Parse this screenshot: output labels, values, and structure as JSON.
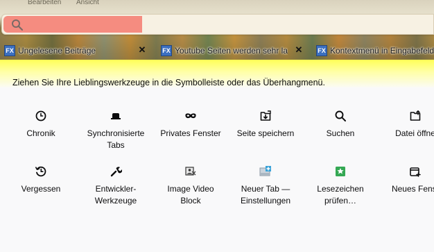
{
  "window": {
    "menu_ghost": [
      "Bearbeiten",
      "Ansicht"
    ]
  },
  "urlbar": {
    "icon": "search-icon",
    "highlight_color": "#f58c80"
  },
  "tabs": [
    {
      "label": "Ungelesene Beiträge",
      "favicon": "FX",
      "close": "✕"
    },
    {
      "label": "Youtube Seiten werden sehr la",
      "favicon": "FX",
      "close": "✕"
    },
    {
      "label": "Kontextmenü in Eingabefeld",
      "favicon": "FX",
      "close": ""
    }
  ],
  "customize": {
    "instruction": "Ziehen Sie Ihre Lieblingswerkzeuge in die Symbolleiste oder das Überhangmenü."
  },
  "palette": [
    {
      "label": "Chronik",
      "icon": "clock-icon"
    },
    {
      "label": "Synchronisierte\nTabs",
      "icon": "sync-tabs-icon"
    },
    {
      "label": "Privates Fenster",
      "icon": "private-mask-icon"
    },
    {
      "label": "Seite speichern",
      "icon": "save-page-icon"
    },
    {
      "label": "Suchen",
      "icon": "search-icon"
    },
    {
      "label": "Datei öffne",
      "icon": "open-file-icon"
    },
    {
      "label": "Vergessen",
      "icon": "forget-icon"
    },
    {
      "label": "Entwickler-\nWerkzeuge",
      "icon": "wrench-icon"
    },
    {
      "label": "Image Video\nBlock",
      "icon": "image-video-block-icon"
    },
    {
      "label": "Neuer Tab —\nEinstellungen",
      "icon": "new-tab-settings-icon"
    },
    {
      "label": "Lesezeichen\nprüfen…",
      "icon": "bookmark-check-icon"
    },
    {
      "label": "Neues Fenst",
      "icon": "new-window-icon"
    }
  ],
  "colors": {
    "accent_yellow": "#ffff56",
    "favicon_blue": "#3b6fc0"
  }
}
